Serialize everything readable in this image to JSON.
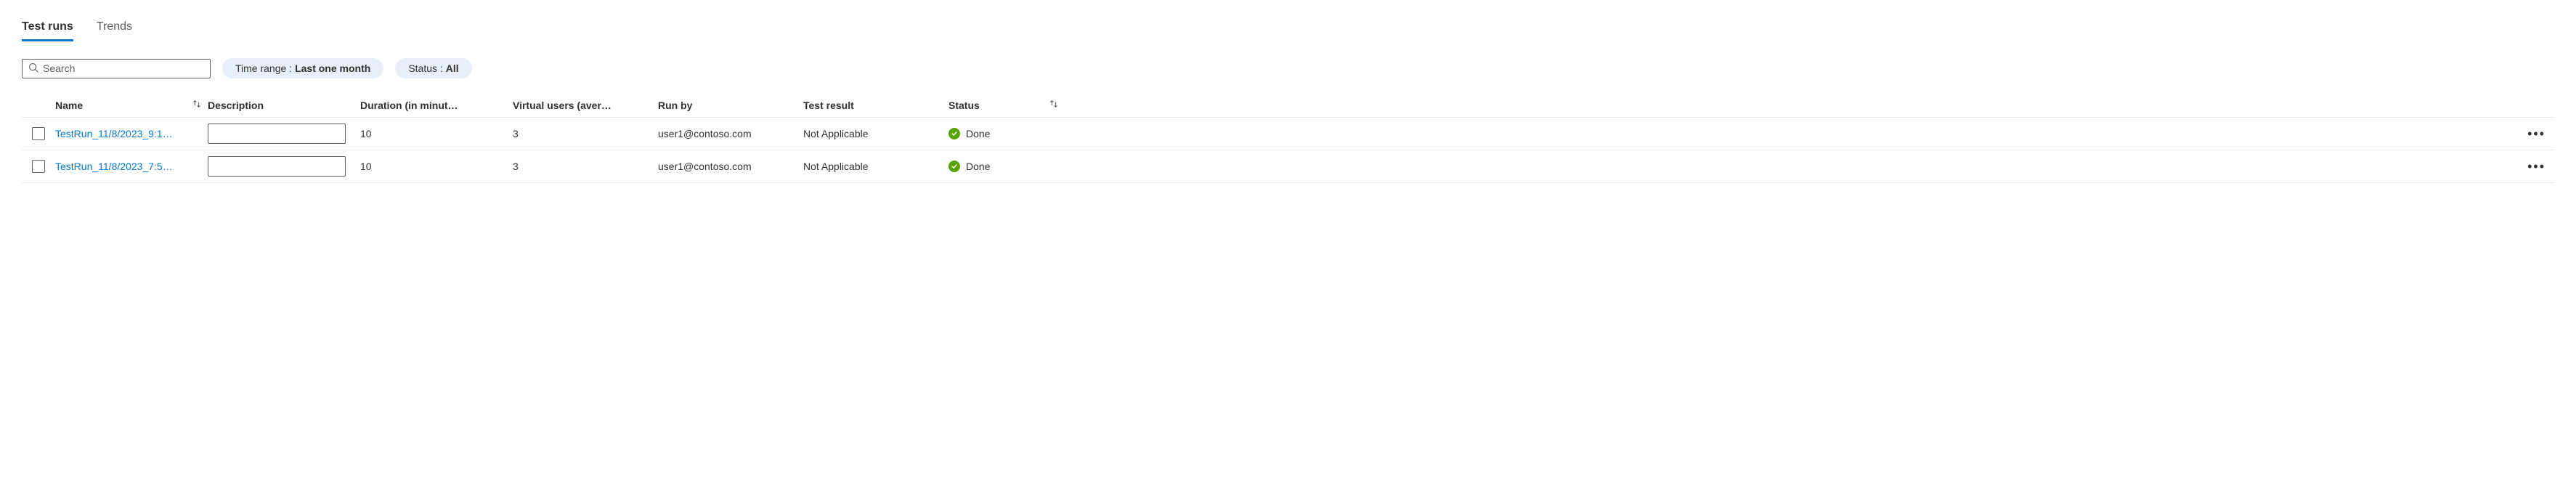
{
  "tabs": {
    "test_runs": "Test runs",
    "trends": "Trends"
  },
  "search": {
    "placeholder": "Search"
  },
  "filters": {
    "time_range_label": "Time range :",
    "time_range_value": "Last one month",
    "status_label": "Status :",
    "status_value": "All"
  },
  "columns": {
    "name": "Name",
    "description": "Description",
    "duration": "Duration (in minut…",
    "virtual_users": "Virtual users (aver…",
    "run_by": "Run by",
    "test_result": "Test result",
    "status": "Status"
  },
  "rows": [
    {
      "name": "TestRun_11/8/2023_9:1…",
      "description": "",
      "duration": "10",
      "virtual_users": "3",
      "run_by": "user1@contoso.com",
      "test_result": "Not Applicable",
      "status": "Done"
    },
    {
      "name": "TestRun_11/8/2023_7:5…",
      "description": "",
      "duration": "10",
      "virtual_users": "3",
      "run_by": "user1@contoso.com",
      "test_result": "Not Applicable",
      "status": "Done"
    }
  ]
}
